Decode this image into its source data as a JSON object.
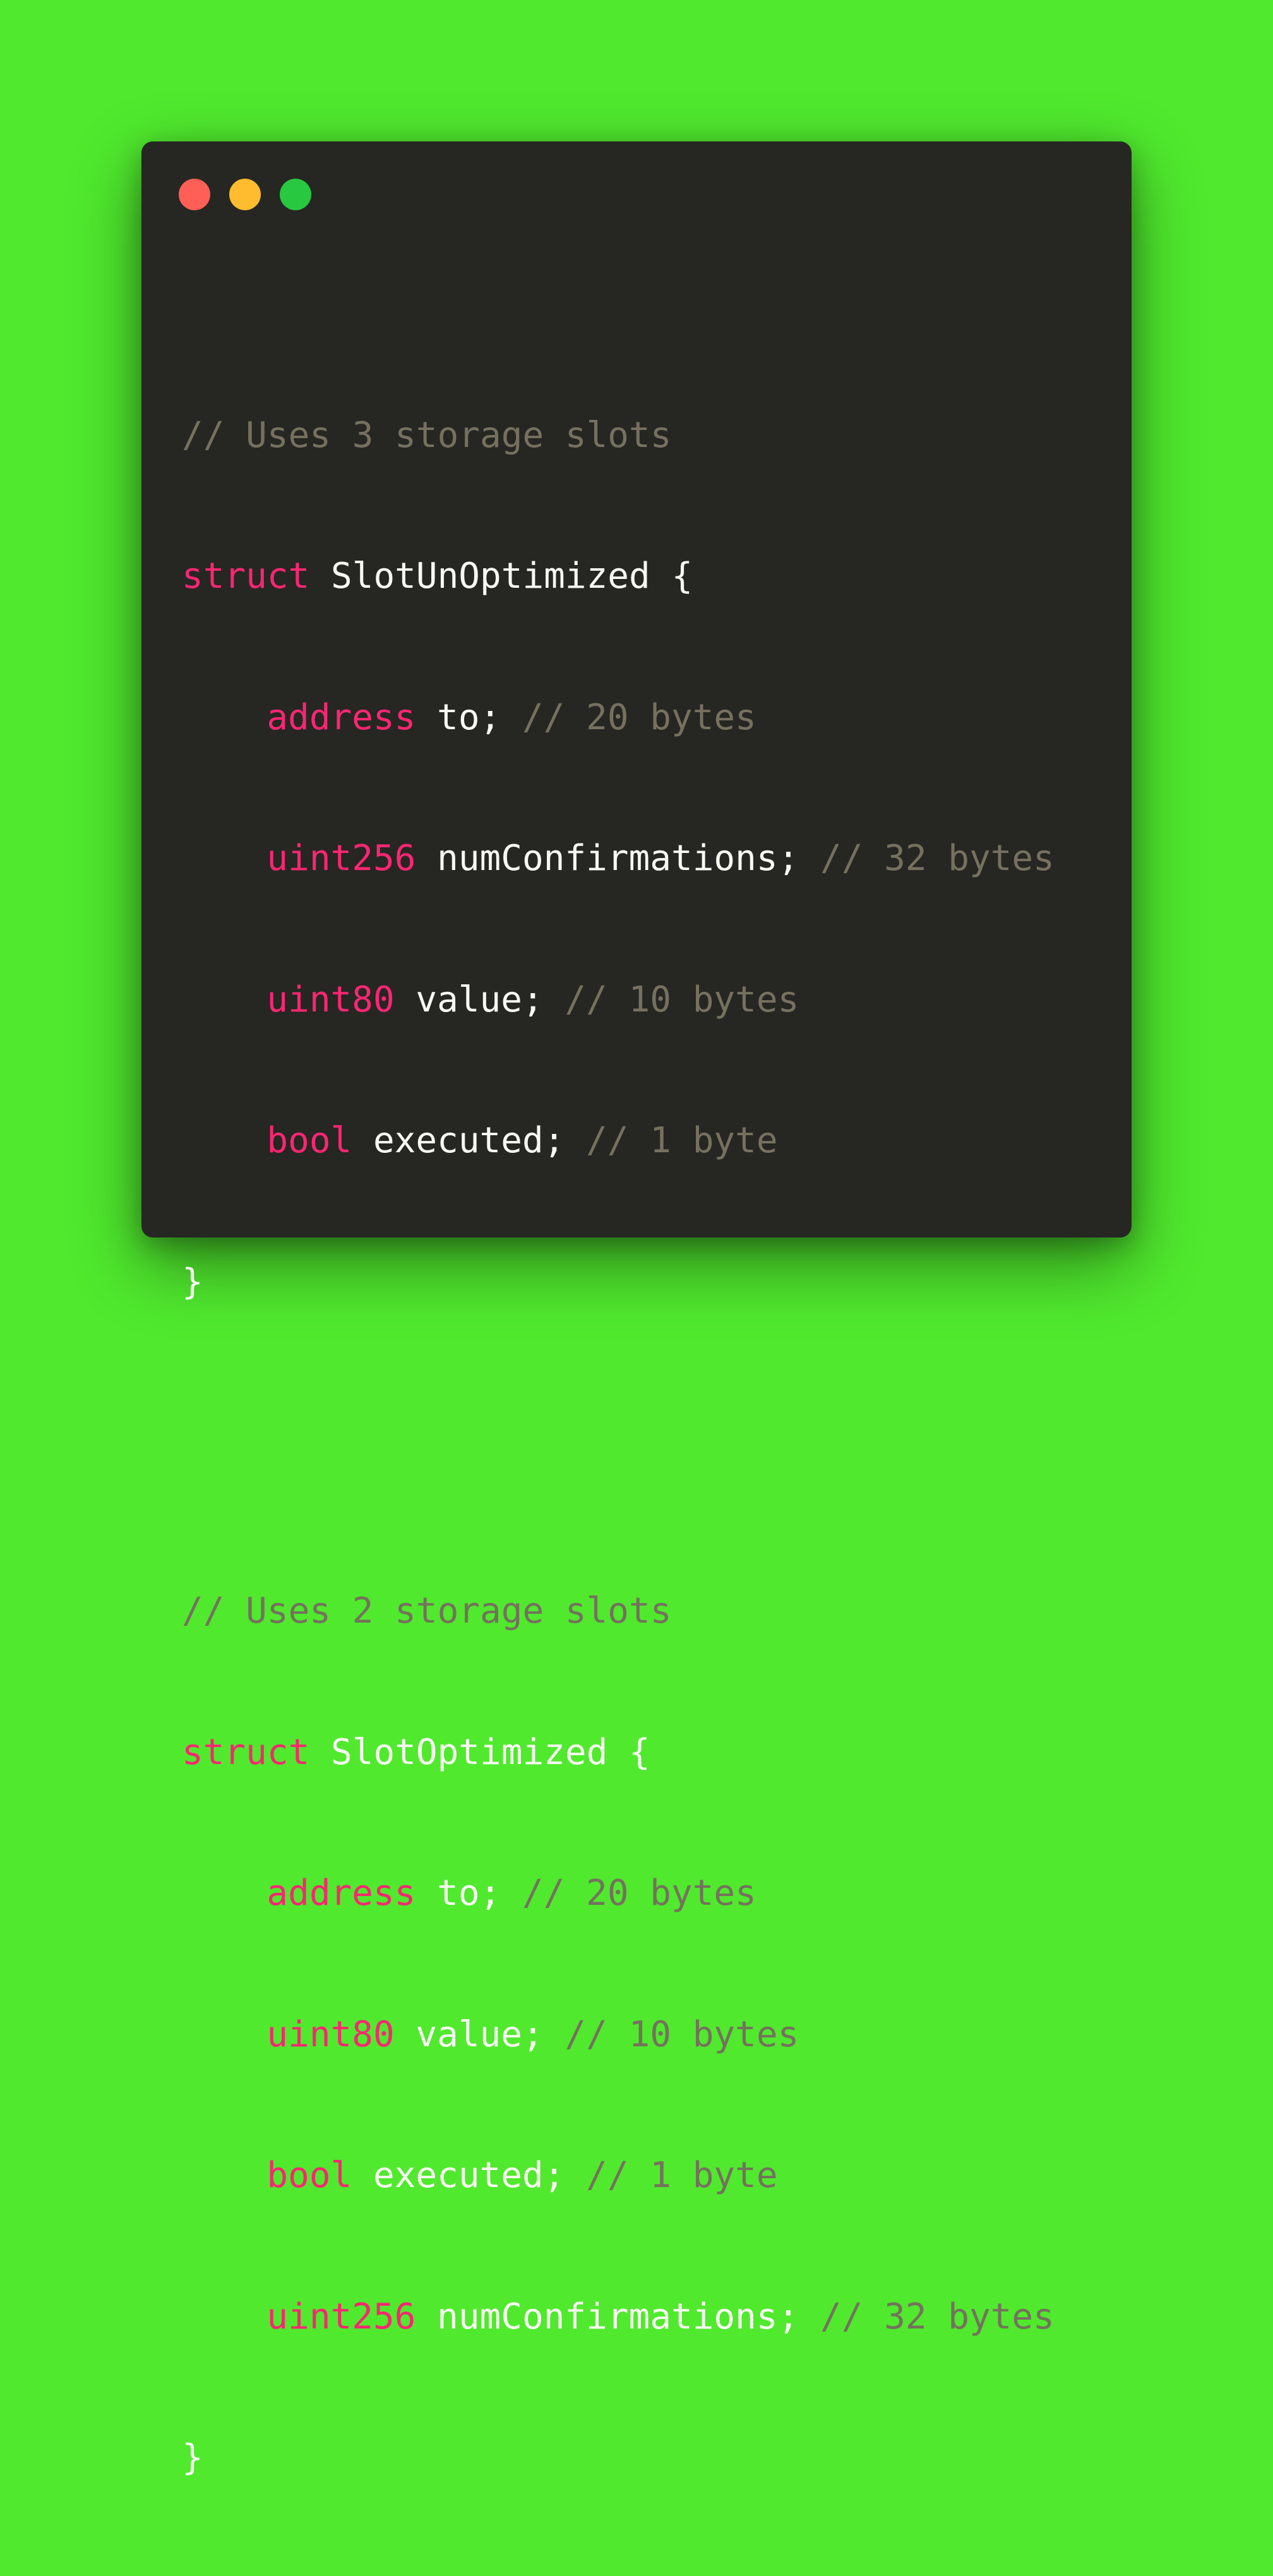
{
  "colors": {
    "background": "#50e92e",
    "window": "#262623",
    "keyword": "#f92672",
    "comment": "#75715e",
    "text": "#f8f8f2",
    "close": "#ff5f57",
    "minimize": "#febc2e",
    "maximize": "#28c840"
  },
  "window_controls": [
    "close",
    "minimize",
    "maximize"
  ],
  "code": {
    "block1": {
      "comment": "// Uses 3 storage slots",
      "keyword": "struct",
      "name_open": "SlotUnOptimized {",
      "fields": [
        {
          "type": "address",
          "decl": "to;",
          "comment": "// 20 bytes"
        },
        {
          "type": "uint256",
          "decl": "numConfirmations;",
          "comment": "// 32 bytes"
        },
        {
          "type": "uint80",
          "decl": "value;",
          "comment": "// 10 bytes"
        },
        {
          "type": "bool",
          "decl": "executed;",
          "comment": "// 1 byte"
        }
      ],
      "close": "}"
    },
    "block2": {
      "comment": "// Uses 2 storage slots",
      "keyword": "struct",
      "name_open": "SlotOptimized {",
      "fields": [
        {
          "type": "address",
          "decl": "to;",
          "comment": "// 20 bytes"
        },
        {
          "type": "uint80",
          "decl": "value;",
          "comment": "// 10 bytes"
        },
        {
          "type": "bool",
          "decl": "executed;",
          "comment": "// 1 byte"
        },
        {
          "type": "uint256",
          "decl": "numConfirmations;",
          "comment": "// 32 bytes"
        }
      ],
      "close": "}"
    }
  }
}
